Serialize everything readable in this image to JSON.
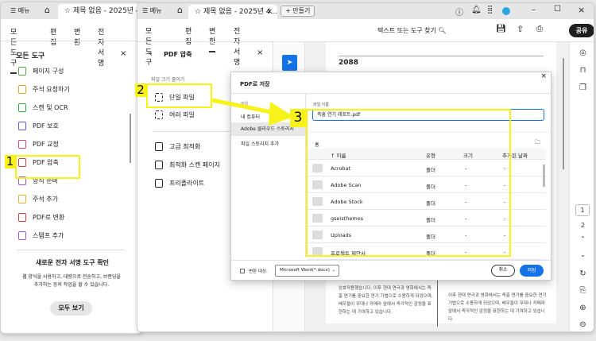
{
  "back_window": {
    "menu": "메뉴",
    "tab_title": "제목 없음 - 2025년 4.",
    "nav": [
      "모든 도구",
      "편집",
      "변환",
      "전자 서명"
    ],
    "panel_title": "모든 도구",
    "tools": [
      {
        "label": "페이지 구성",
        "color": "#5aa64a"
      },
      {
        "label": "주석 요청하기",
        "color": "#d9a22a"
      },
      {
        "label": "스캔 및 OCR",
        "color": "#3aa14b"
      },
      {
        "label": "PDF 보호",
        "color": "#5a5ad6"
      },
      {
        "label": "PDF 교정",
        "color": "#d5457a"
      },
      {
        "label": "PDF 압축",
        "color": "#d63b3b"
      },
      {
        "label": "양식 준비",
        "color": "#9a58d6"
      },
      {
        "label": "주석 추가",
        "color": "#e0b42a"
      },
      {
        "label": "PDF로 변환",
        "color": "#d63b3b"
      },
      {
        "label": "스탬프 추가",
        "color": "#9a58d6"
      }
    ],
    "promo_title": "새로운 전자 서명 도구 확인",
    "promo_text": "웹 양식을 사용하고, 대량으로 전송하고, 브랜딩을 추가하는 등의 작업을 할 수 있습니다.",
    "promo_button": "모두 보기"
  },
  "front_window": {
    "menu": "메뉴",
    "tab_title": "제목 없음 - 2025년 4...",
    "new_tab": "+ 만들기",
    "nav": [
      "모든 도구",
      "편집",
      "변환",
      "전자 서명"
    ],
    "active_nav": "변환",
    "search": "텍스트 또는 도구 찾기",
    "share": "공유",
    "panel_title": "PDF 압축",
    "section_label": "파일 크기 줄이기",
    "options": [
      "단일 파일",
      "여러 파일"
    ],
    "advanced": [
      "고급 최적화",
      "최적화 스캔 페이지",
      "프리플라이트"
    ],
    "doc_heading": "2088",
    "doc_left": "상호작용했습니다. 이후 현대 연극과 영화에서는 즉흥 연기를 중요한 연기 기법으로 수용하게 되었으며, 배우들이 무대나 카메라 앞에서 즉각적인 감정을 표현하는 데 기여하고 있습니다.",
    "doc_right": "이후 현대 연극과 영화에서는 즉흥 연기를 중요한 연기 기법으로 수용하게 되었으며, 배우들이 무대나 카메라 앞에서 즉각적인 감정을 표현하는 데 기여하고 있습니다.",
    "pages": [
      "1",
      "2"
    ],
    "current_page": "1"
  },
  "dialog": {
    "title": "PDF로 저장",
    "side_label": "파일",
    "side_items": [
      "내 컴퓨터",
      "Adobe 클라우드 스토리지",
      "파일 스토리지 추가"
    ],
    "selected": "Adobe 클라우드 스토리지",
    "filename_label": "파일 이름",
    "filename": "즉흥 연기 레포트.pdf",
    "location": "홈",
    "columns": [
      "↑ 이름",
      "유형",
      "크기",
      "추가된 날짜"
    ],
    "rows": [
      {
        "name": "Acrobat",
        "type": "폴더",
        "size": "-",
        "date": "-"
      },
      {
        "name": "Adobe Scan",
        "type": "폴더",
        "size": "-",
        "date": "-"
      },
      {
        "name": "Adobe Stock",
        "type": "폴더",
        "size": "-",
        "date": "-"
      },
      {
        "name": "gseisthemes",
        "type": "폴더",
        "size": "-",
        "date": "-"
      },
      {
        "name": "Uploads",
        "type": "폴더",
        "size": "-",
        "date": "-"
      },
      {
        "name": "프로젝트 제안서",
        "type": "폴더",
        "size": "-",
        "date": "-"
      }
    ],
    "convert_label": "변환 대상:",
    "convert_value": "Microsoft Word(*.docx)",
    "cancel": "취소",
    "save": "저장"
  },
  "annotations": [
    "1",
    "2",
    "3"
  ],
  "colors": {
    "highlight": "#f7f21a",
    "primary": "#1473e6",
    "share": "#1e1e1e"
  }
}
